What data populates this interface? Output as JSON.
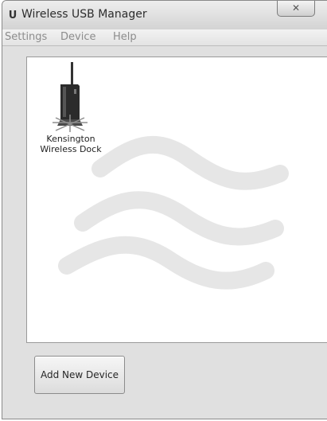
{
  "window": {
    "title": "Wireless USB Manager",
    "app_icon_letter": "U",
    "close_glyph": "✕"
  },
  "menu": {
    "items": [
      {
        "label": "Settings"
      },
      {
        "label": "Device"
      },
      {
        "label": "Help"
      }
    ]
  },
  "devices": [
    {
      "label": "Kensington Wireless Dock",
      "icon": "wireless-dock-icon"
    }
  ],
  "actions": {
    "add_new_device_label": "Add New Device"
  },
  "colors": {
    "watermark": "#e6e6e6",
    "menu_text": "#8c8c8c"
  }
}
